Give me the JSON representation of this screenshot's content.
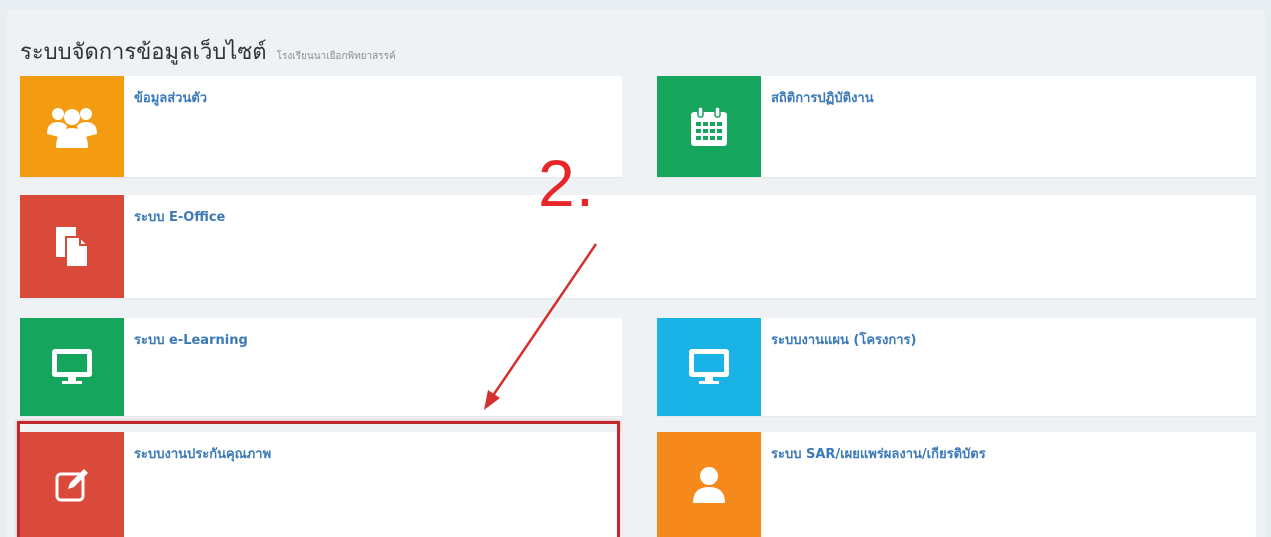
{
  "header": {
    "title": "ระบบจัดการข้อมูลเว็บไซต์",
    "subtitle": "โรงเรียนนาเยือกพิทยาสรรค์"
  },
  "tiles": [
    {
      "label": "ข้อมูลส่วนตัว",
      "icon": "users-icon",
      "color": "#f39c12"
    },
    {
      "label": "สถิติการปฏิบัติงาน",
      "icon": "calendar-icon",
      "color": "#16a55d"
    },
    {
      "label": "ระบบ E-Office",
      "icon": "documents-icon",
      "color": "#d94a3b"
    },
    {
      "label": "ระบบ e-Learning",
      "icon": "monitor-icon",
      "color": "#16a55d"
    },
    {
      "label": "ระบบงานแผน (โครงการ)",
      "icon": "monitor-icon",
      "color": "#19b3e6"
    },
    {
      "label": "ระบบงานประกันคุณภาพ",
      "icon": "edit-icon",
      "color": "#d94a3b"
    },
    {
      "label": "ระบบ SAR/เผยแพร่ผลงาน/เกียรติบัตร",
      "icon": "user-icon",
      "color": "#f5891c"
    }
  ],
  "annotation": {
    "step_label": "2.",
    "color": "#e8262a"
  }
}
